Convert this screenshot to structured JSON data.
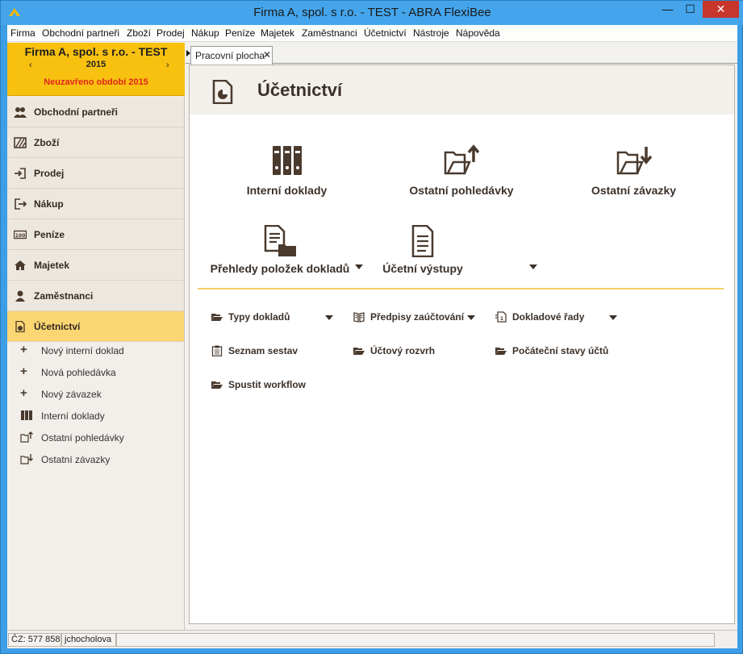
{
  "window": {
    "title": "Firma A, spol. s r.o. - TEST - ABRA FlexiBee",
    "minimize": "—",
    "maximize": "☐",
    "close": "✕"
  },
  "menu": [
    "Firma",
    "Obchodní partneři",
    "Zboží",
    "Prodej",
    "Nákup",
    "Peníze",
    "Majetek",
    "Zaměstnanci",
    "Účetnictví",
    "Nástroje",
    "Nápověda"
  ],
  "company": {
    "name": "Firma A, spol. s r.o. - TEST",
    "year": "2015",
    "prev": "‹",
    "next": "›",
    "period": "Neuzavřeno období 2015"
  },
  "nav": [
    {
      "label": "Obchodní partneři",
      "icon": "partners-icon"
    },
    {
      "label": "Zboží",
      "icon": "goods-icon"
    },
    {
      "label": "Prodej",
      "icon": "sale-icon"
    },
    {
      "label": "Nákup",
      "icon": "purchase-icon"
    },
    {
      "label": "Peníze",
      "icon": "money-icon"
    },
    {
      "label": "Majetek",
      "icon": "property-icon"
    },
    {
      "label": "Zaměstnanci",
      "icon": "employee-icon"
    },
    {
      "label": "Účetnictví",
      "icon": "accounting-icon",
      "active": true
    }
  ],
  "subnav": [
    {
      "label": "Nový interní doklad",
      "icon": "plus-icon"
    },
    {
      "label": "Nová pohledávka",
      "icon": "plus-icon"
    },
    {
      "label": "Nový závazek",
      "icon": "plus-icon"
    },
    {
      "label": "Interní doklady",
      "icon": "binders-icon"
    },
    {
      "label": "Ostatní pohledávky",
      "icon": "folder-upload-icon"
    },
    {
      "label": "Ostatní závazky",
      "icon": "folder-download-icon"
    }
  ],
  "tab": {
    "label": "Pracovní plocha",
    "close": "✕"
  },
  "pane": {
    "title": "Účetnictví",
    "big_buttons": [
      {
        "label": "Interní doklady",
        "icon": "binders-icon"
      },
      {
        "label": "Ostatní pohledávky",
        "icon": "folder-upload-icon"
      },
      {
        "label": "Ostatní závazky",
        "icon": "folder-download-icon"
      },
      {
        "label": "Přehledy položek dokladů",
        "icon": "document-folder-icon"
      },
      {
        "label": "Účetní výstupy",
        "icon": "document-icon"
      }
    ],
    "links": [
      {
        "label": "Typy dokladů",
        "icon": "folder-open-icon"
      },
      {
        "label": "Předpisy zaúčtování",
        "icon": "book-icon"
      },
      {
        "label": "Dokladové řady",
        "icon": "series-icon"
      },
      {
        "label": "Seznam sestav",
        "icon": "clipboard-icon"
      },
      {
        "label": "Účtový rozvrh",
        "icon": "folder-open-icon"
      },
      {
        "label": "Počáteční stavy účtů",
        "icon": "folder-open-icon"
      },
      {
        "label": "Spustit workflow",
        "icon": "folder-open-icon"
      }
    ]
  },
  "status": {
    "cz": "ČZ: 577 858",
    "user": "jchocholova"
  },
  "colors": {
    "titlebar": "#44a5ec",
    "company_bg": "#f8c10f",
    "active_nav": "#fbd672",
    "period_text": "#e0251b",
    "icon_brown": "#4a3a2e",
    "separator": "#f7cf66"
  }
}
